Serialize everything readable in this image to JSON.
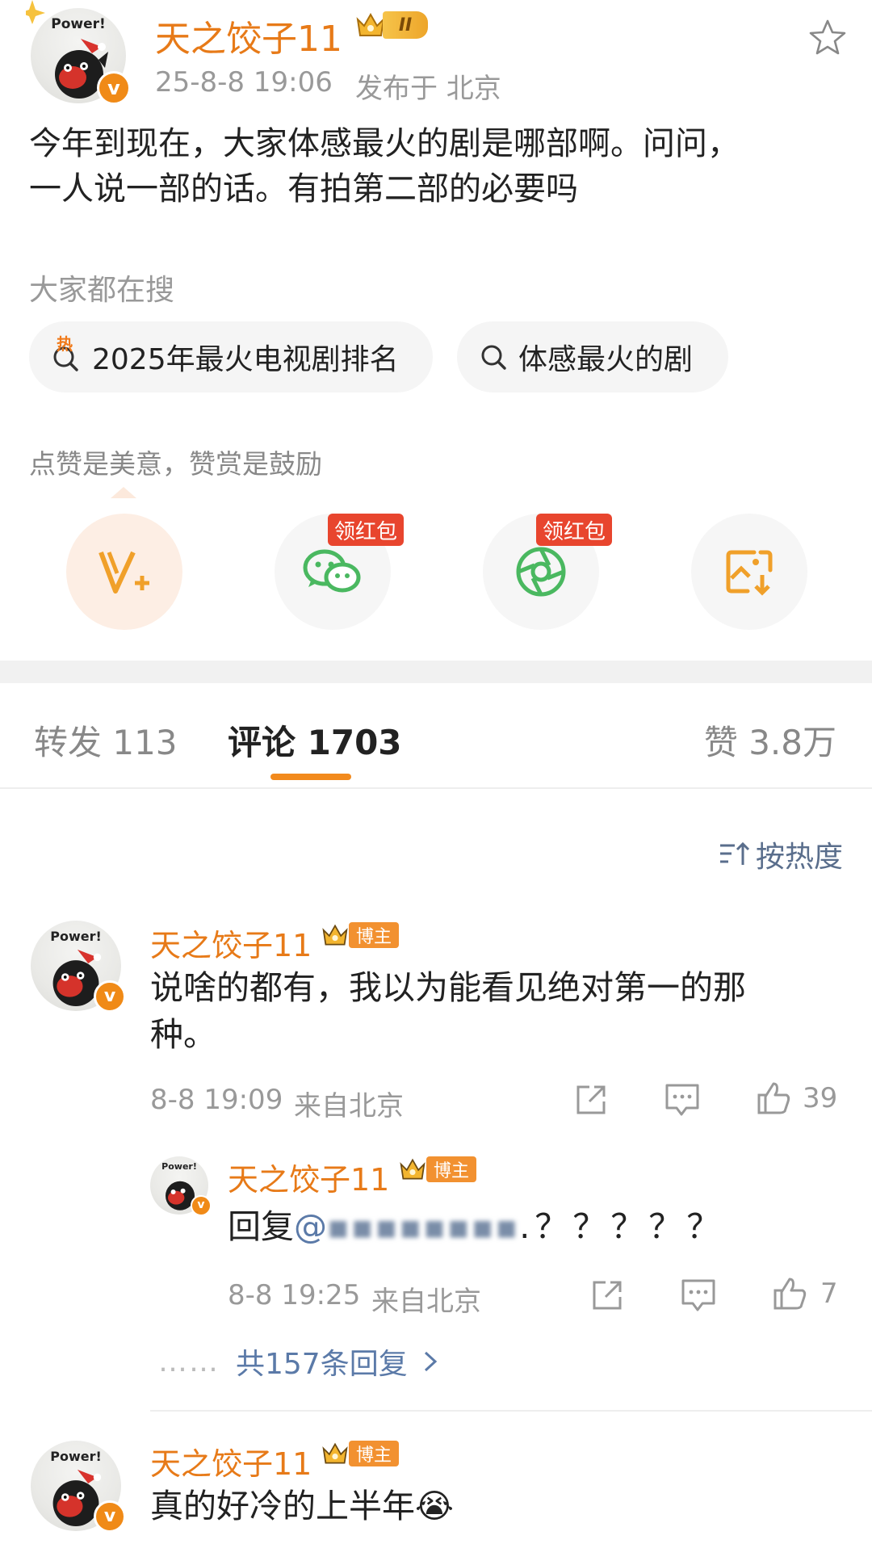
{
  "post": {
    "author": "天之饺子11",
    "level": "II",
    "time": "25-8-8 19:06",
    "location": "发布于 北京",
    "text_line1": "今年到现在，大家体感最火的剧是哪部啊。问问，",
    "text_line2": "一人说一部的话。有拍第二部的必要吗",
    "avatar_text": "Power!"
  },
  "search": {
    "title": "大家都在搜",
    "chips": [
      {
        "label": "2025年最火电视剧排名",
        "icon": "hot-search-icon",
        "hot_mark": "热"
      },
      {
        "label": "体感最火的剧",
        "icon": "search-icon"
      }
    ]
  },
  "appreciate": {
    "tip": "点赞是美意，赞赏是鼓励",
    "red_packet_label": "领红包",
    "actions": [
      "v-plus-icon",
      "wechat-icon",
      "moments-icon",
      "save-image-icon"
    ]
  },
  "tabs": [
    {
      "label": "转发 113"
    },
    {
      "label": "评论 1703",
      "active": true
    },
    {
      "label": "赞 3.8万"
    }
  ],
  "sort": {
    "label": "按热度"
  },
  "comments": [
    {
      "author": "天之饺子11",
      "badge": "博主",
      "text_line1": "说啥的都有，我以为能看见绝对第一的那",
      "text_line2": "种。",
      "time": "8-8 19:09",
      "location": "来自北京",
      "likes": "39",
      "reply": {
        "author": "天之饺子11",
        "badge": "博主",
        "reply_prefix": "回复",
        "at_user": "@",
        "blurred_name": "▪▪▪▪▪▪▪▪",
        "text_suffix": ".？？？？？",
        "time": "8-8 19:25",
        "location": "来自北京",
        "likes": "7"
      },
      "more_replies": "共157条回复",
      "more_dots": "……"
    },
    {
      "author": "天之饺子11",
      "badge": "博主",
      "text": "真的好冷的上半年",
      "emoji": "😭"
    }
  ],
  "colors": {
    "name_orange": "#e77a18",
    "link_blue": "#5b7aa8",
    "tab_underline": "#f28a1d",
    "red_packet": "#e8452e"
  }
}
